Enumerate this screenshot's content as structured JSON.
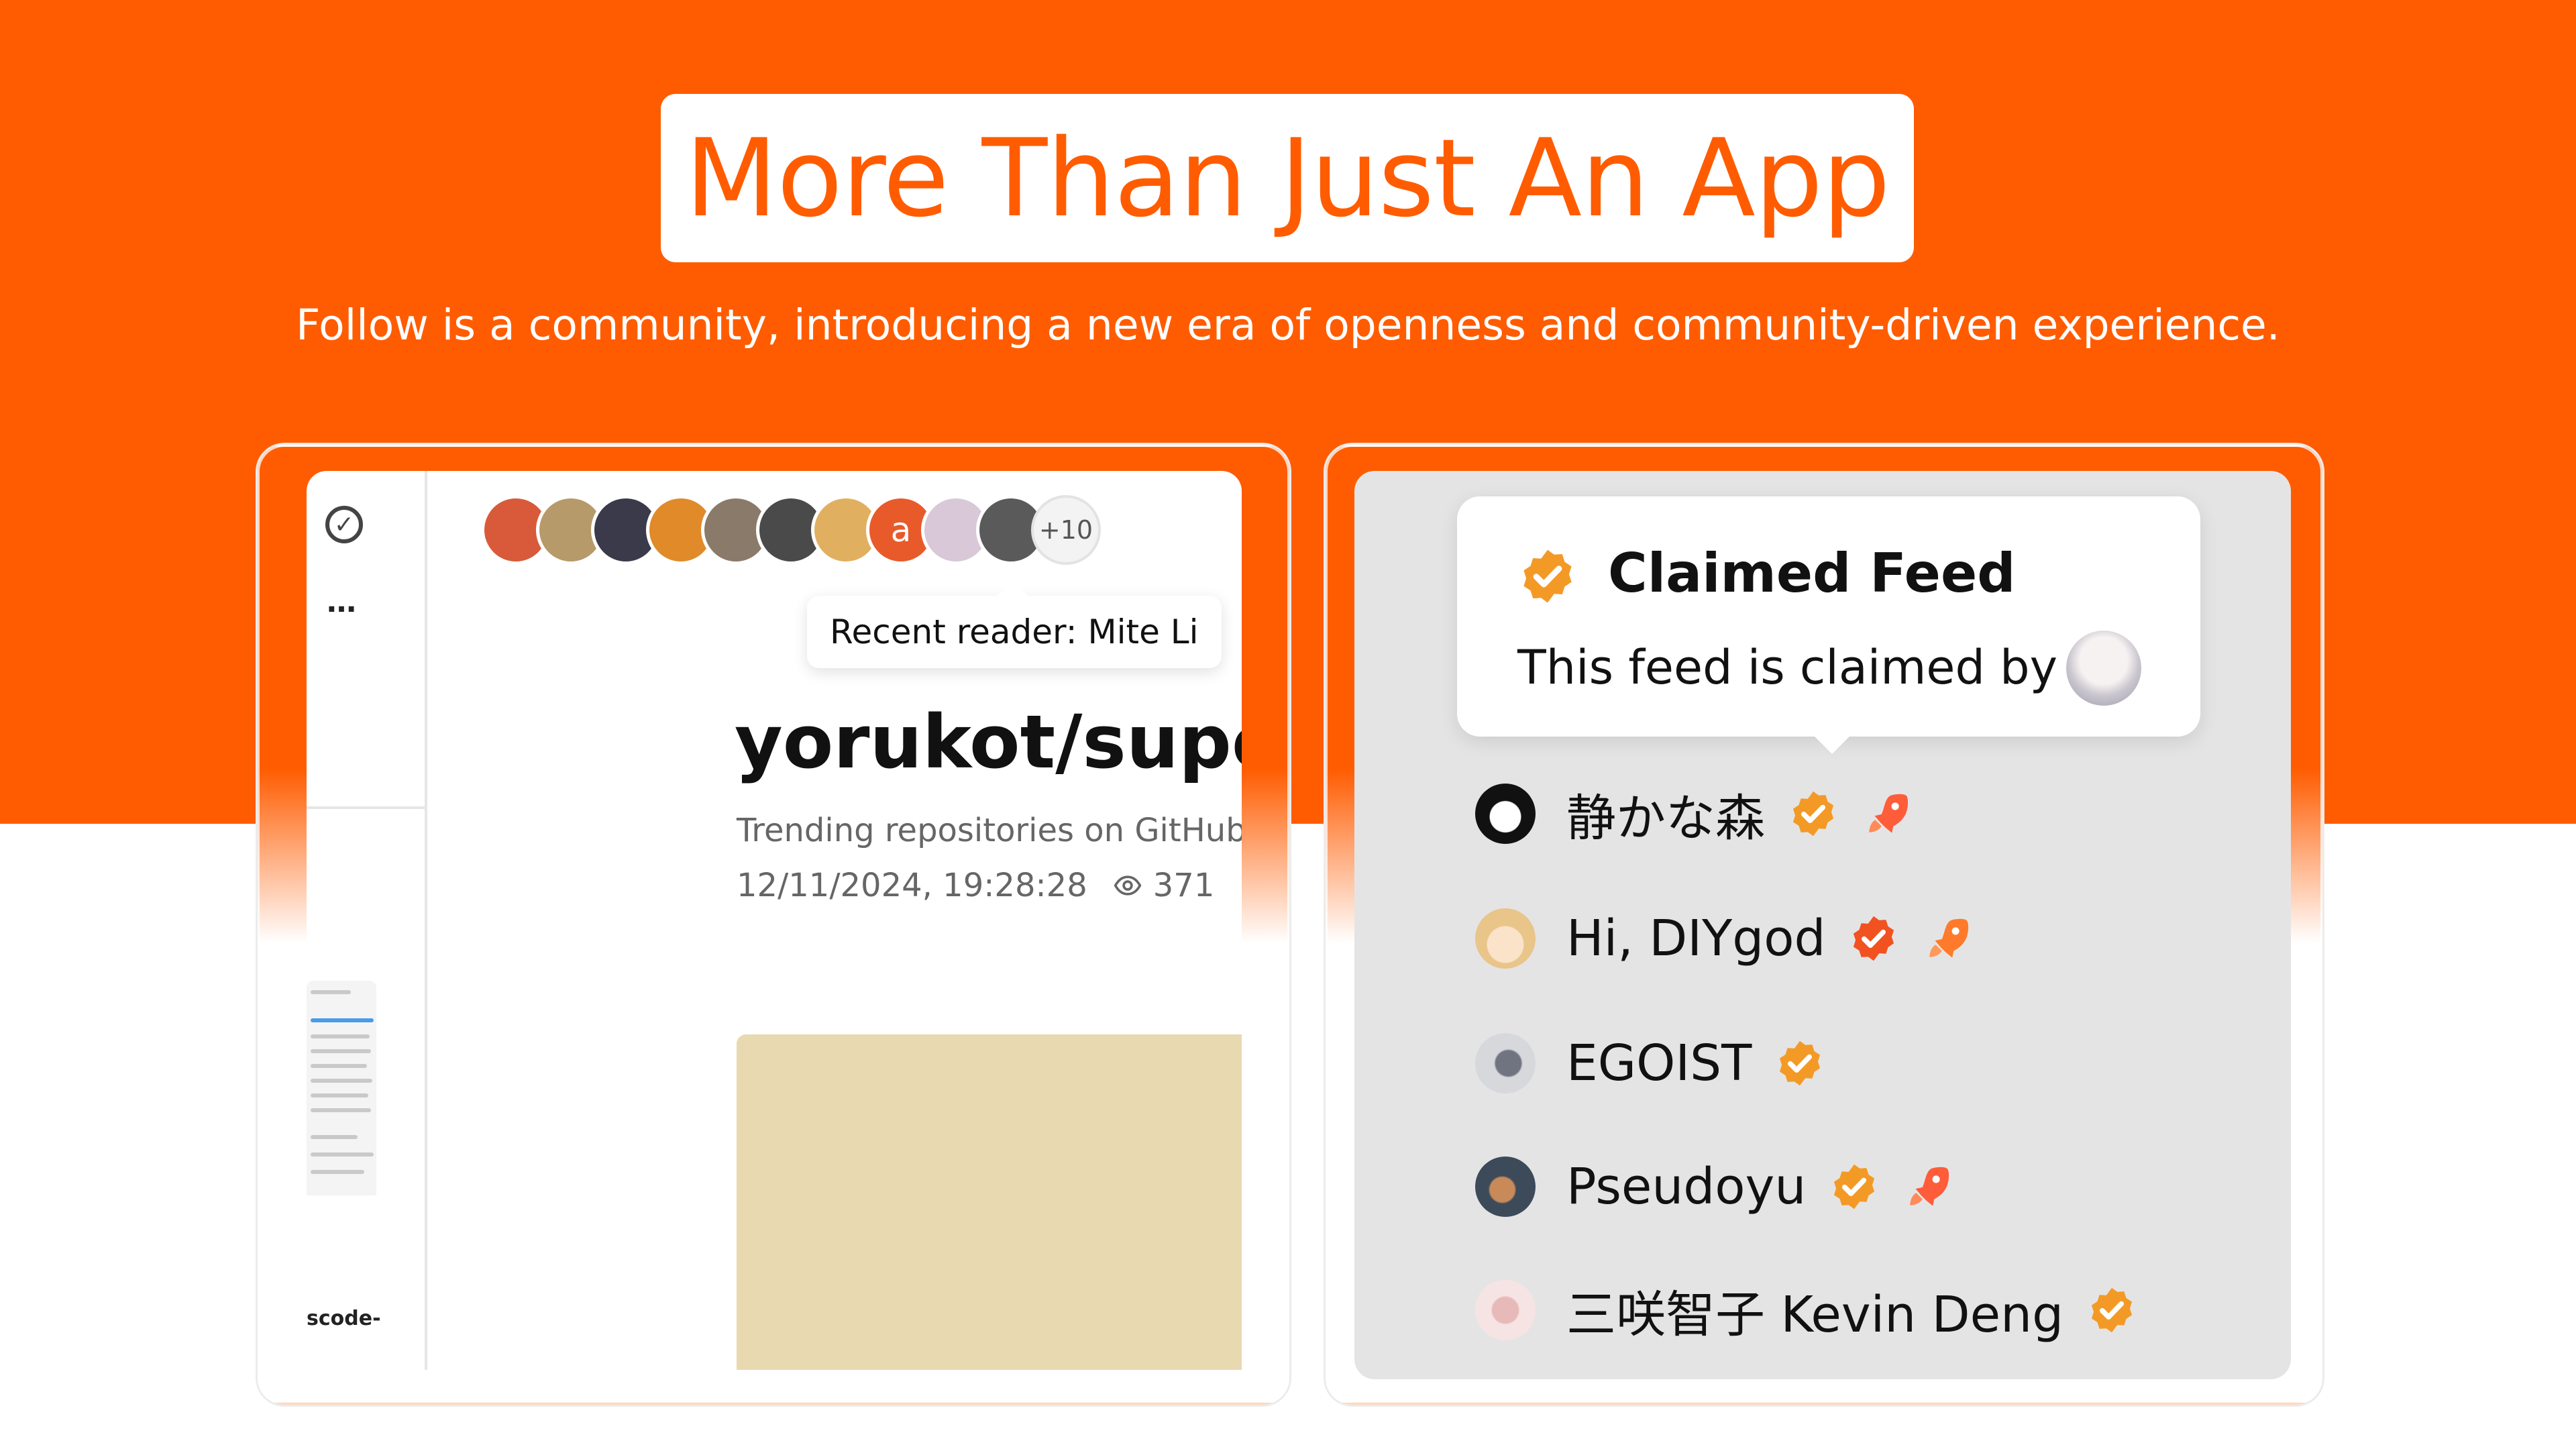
{
  "hero": {
    "title": "More Than Just An App",
    "subtitle": "Follow is a community, introducing a new era of openness and community-driven experience.",
    "brand_color": "#FF5C01"
  },
  "left_card": {
    "sidebar": {
      "check_icon": "check-circle-icon",
      "more_label": "…",
      "mini_label": "scode-"
    },
    "readers": {
      "avatar_colors": [
        "#d85a3a",
        "#b79a6a",
        "#3a3a4a",
        "#e08a2a",
        "#8a7a6a",
        "#4a4a4a",
        "#e0b060",
        "#E85A2A",
        "#d8c8d8",
        "#5a5a5a"
      ],
      "letter_avatar": "a",
      "more_count": "+10",
      "tooltip": "Recent reader: Mite Li"
    },
    "entry": {
      "title": "yorukot/super",
      "description": "Trending repositories on GitHub",
      "timestamp": "12/11/2024, 19:28:28",
      "views": "371",
      "image_color": "#E9D9B0"
    }
  },
  "right_card": {
    "popover": {
      "title": "Claimed Feed",
      "text": "This feed is claimed by",
      "badge_color": "#F39A26"
    },
    "users": [
      {
        "name": "静かな森",
        "verified": true,
        "rocket": true,
        "avatar_color": "#111111"
      },
      {
        "name": "Hi, DIYgod",
        "verified": true,
        "rocket": true,
        "avatar_color": "#e9c58a"
      },
      {
        "name": "EGOIST",
        "verified": true,
        "rocket": false,
        "avatar_color": "#b5b8bd"
      },
      {
        "name": "Pseudoyu",
        "verified": true,
        "rocket": true,
        "avatar_color": "#3c4a5a"
      },
      {
        "name": "三咲智子 Kevin Deng",
        "verified": true,
        "rocket": false,
        "avatar_color": "#f1d2d2"
      }
    ],
    "verified_icon": "verified-badge-icon",
    "rocket_icon": "rocket-icon",
    "rocket_color": "#FF5C3A"
  }
}
